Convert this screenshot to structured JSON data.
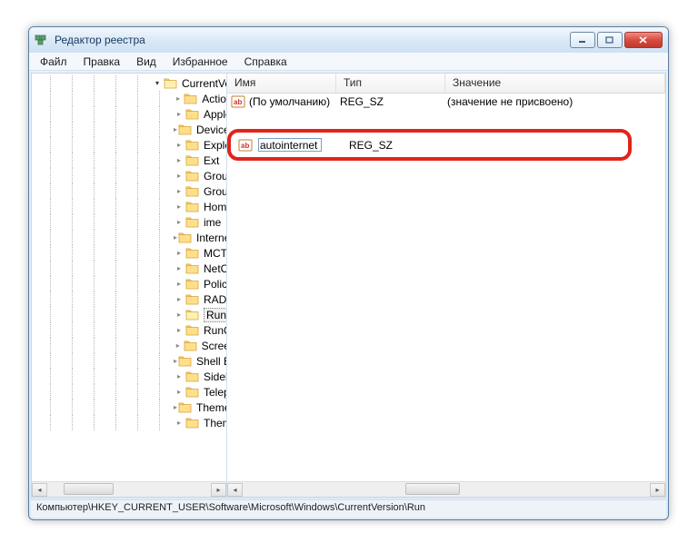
{
  "window": {
    "title": "Редактор реестра"
  },
  "menu": {
    "file": "Файл",
    "edit": "Правка",
    "view": "Вид",
    "favorites": "Избранное",
    "help": "Справка"
  },
  "tree": {
    "parent": "CurrentVersion",
    "items": [
      "Action Center",
      "Applets",
      "Device Metadata",
      "Explorer",
      "Ext",
      "Group Policy",
      "Group Policy",
      "HomeGroup",
      "ime",
      "Internet Settings",
      "MCT",
      "NetCache",
      "Policies",
      "RADAR",
      "Run",
      "RunOnce",
      "Screensavers",
      "Shell Extensions",
      "Sidebar",
      "Telephony",
      "ThemeManager",
      "Themes"
    ],
    "selected_index": 14
  },
  "columns": {
    "name": "Имя",
    "type": "Тип",
    "value": "Значение"
  },
  "rows": {
    "default": {
      "name": "(По умолчанию)",
      "type": "REG_SZ",
      "value": "(значение не присвоено)"
    },
    "editing": {
      "name": "autointernet",
      "type": "REG_SZ",
      "value": ""
    }
  },
  "statusbar": "Компьютер\\HKEY_CURRENT_USER\\Software\\Microsoft\\Windows\\CurrentVersion\\Run"
}
